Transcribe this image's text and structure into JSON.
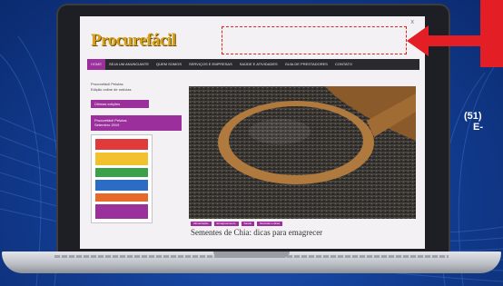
{
  "site": {
    "logo": "Procurefácil",
    "corner_mark": "x",
    "nav": [
      {
        "label": "Home",
        "active": true
      },
      {
        "label": "Seja um anunciante",
        "active": false
      },
      {
        "label": "Quem somos",
        "active": false
      },
      {
        "label": "Serviços e empresas",
        "active": false
      },
      {
        "label": "Saúde e atividades",
        "active": false
      },
      {
        "label": "Guia de prestadores",
        "active": false
      },
      {
        "label": "Contato",
        "active": false
      }
    ]
  },
  "sidebar": {
    "text_line1": "Procurefácil Pelotas",
    "text_line2": "Edição online de notícias",
    "button_label": "Últimas edições",
    "box_line1": "Procurefácil Pelotas",
    "box_line2": "Setembro 2019"
  },
  "main": {
    "tags": [
      "Alimentação",
      "Emagrecimento",
      "Saúde",
      "Receitas e dicas"
    ],
    "headline": "Sementes de Chia: dicas para emagrecer"
  },
  "callout": {
    "color": "#e31e24",
    "contact_line1": "(51)",
    "contact_line2": "E-"
  },
  "colors": {
    "accent": "#9b2f9c",
    "nav_bg": "#2a2a2e",
    "logo": "#d8a21b",
    "background": "#133f96"
  }
}
